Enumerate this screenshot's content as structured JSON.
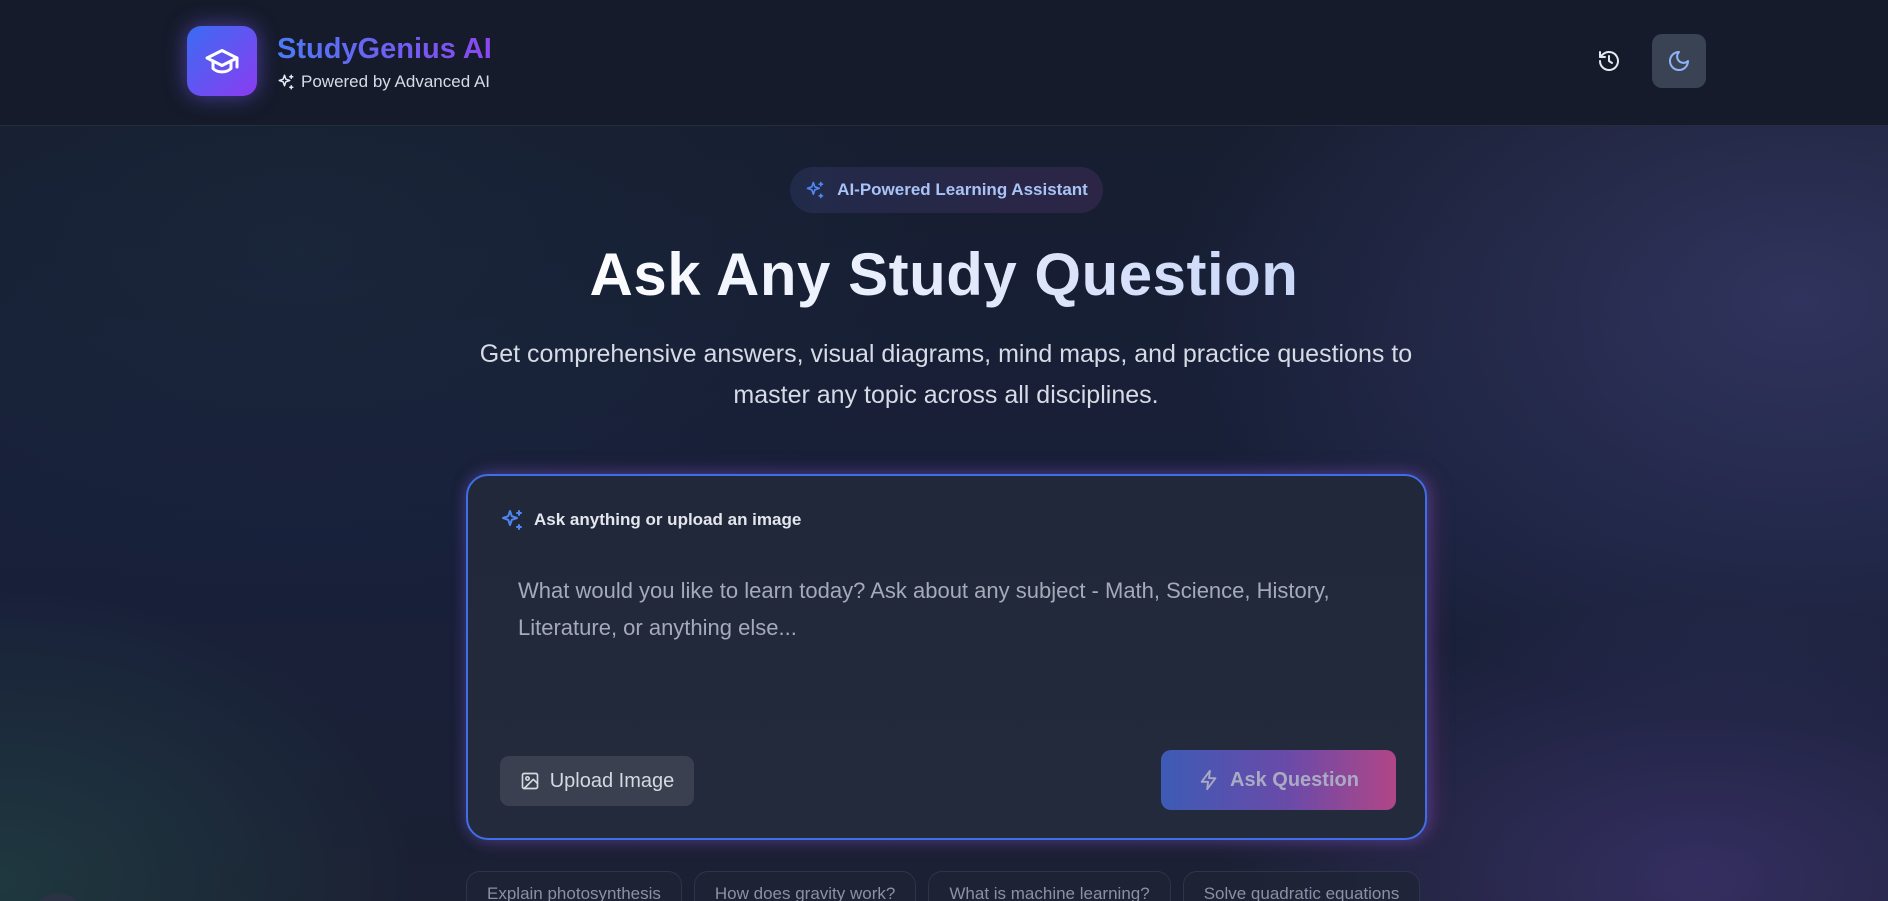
{
  "header": {
    "brand_name": "StudyGenius AI",
    "brand_tagline": "Powered by Advanced AI",
    "logo_icon": "graduation-cap-icon",
    "history_icon": "history-icon",
    "theme_icon": "moon-icon"
  },
  "hero": {
    "badge": "AI-Powered Learning Assistant",
    "title": "Ask Any Study Question",
    "description": "Get comprehensive answers, visual diagrams, mind maps, and practice questions to master any topic across all disciplines."
  },
  "ask_card": {
    "label": "Ask anything or upload an image",
    "input_value": "",
    "input_placeholder": "What would you like to learn today? Ask about any subject - Math, Science, History, Literature, or anything else...",
    "upload_label": "Upload Image",
    "ask_label": "Ask Question"
  },
  "suggestions": [
    "Explain photosynthesis",
    "How does gravity work?",
    "What is machine learning?",
    "Solve quadratic equations"
  ],
  "colors": {
    "accent_blue": "#3f6ee8",
    "accent_purple": "#8a3cf0",
    "accent_pink": "#b14687",
    "background": "#141a2a"
  }
}
